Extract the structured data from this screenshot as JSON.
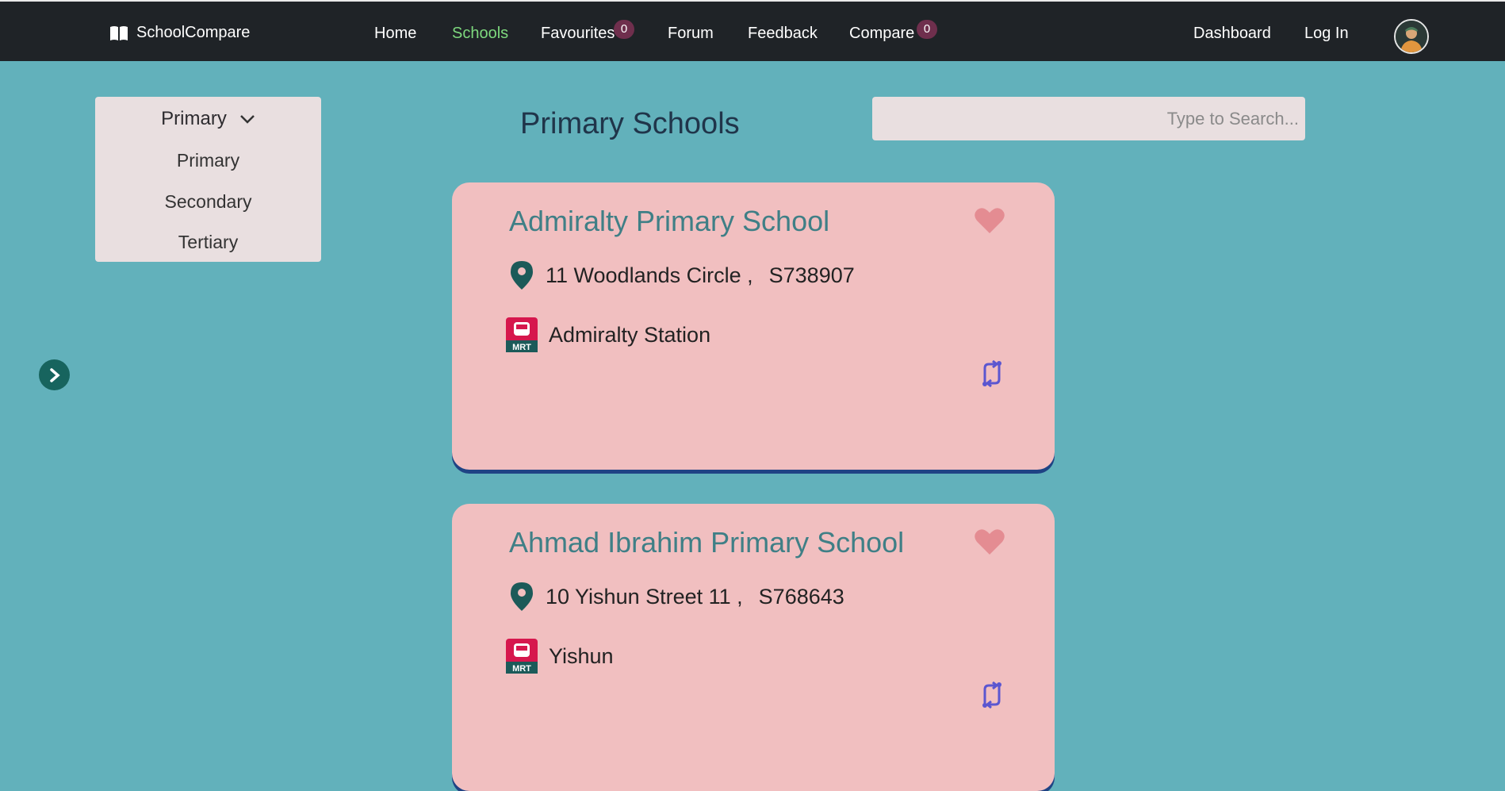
{
  "nav": {
    "brand": "SchoolCompare",
    "home": "Home",
    "schools": "Schools",
    "favourites": "Favourites",
    "favourites_count": "0",
    "forum": "Forum",
    "feedback": "Feedback",
    "compare": "Compare",
    "compare_count": "0",
    "dashboard": "Dashboard",
    "login": "Log In",
    "active_color": "#7ed97e"
  },
  "sidebar": {
    "selected": "Primary",
    "items": [
      "Primary",
      "Secondary",
      "Tertiary"
    ]
  },
  "page": {
    "title": "Primary Schools",
    "search_placeholder": "Type to Search..."
  },
  "schools": [
    {
      "name": "Admiralty Primary School",
      "address": "11 Woodlands Circle ,",
      "postal": "S738907",
      "mrt": "Admiralty Station",
      "mrt_label": "MRT"
    },
    {
      "name": "Ahmad Ibrahim Primary School",
      "address": "10 Yishun Street 11 ,",
      "postal": "S768643",
      "mrt": "Yishun",
      "mrt_label": "MRT"
    }
  ],
  "icons": [
    "book-icon",
    "chevron-down-icon",
    "chevron-right-icon",
    "heart-icon",
    "location-pin-icon",
    "mrt-icon",
    "compare-icon",
    "avatar"
  ]
}
